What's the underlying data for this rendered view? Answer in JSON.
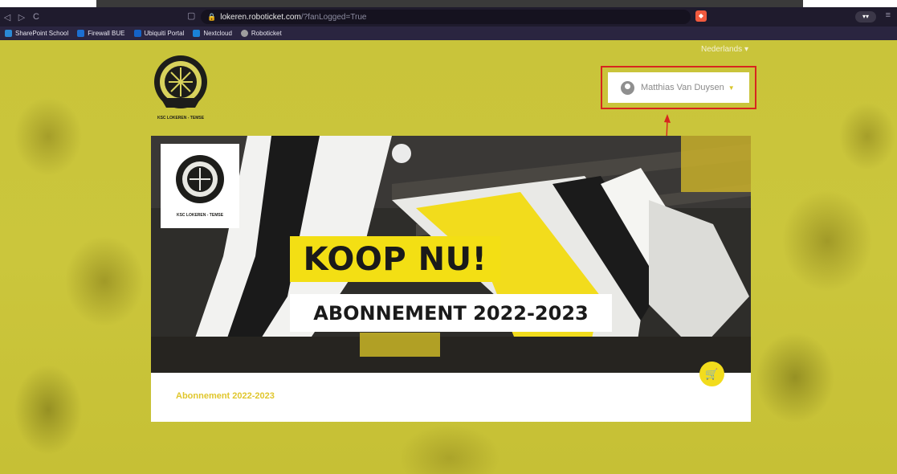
{
  "browser": {
    "url_host": "lokeren.roboticket.com",
    "url_path": "/?fanLogged=True",
    "bookmarks": [
      {
        "label": "SharePoint School",
        "color": "#2b8ad6"
      },
      {
        "label": "Firewall BUE",
        "color": "#1c6fd1"
      },
      {
        "label": "Ubiquiti Portal",
        "color": "#1463c7"
      },
      {
        "label": "Nextcloud",
        "color": "#1a82d8"
      },
      {
        "label": "Roboticket",
        "color": "#9e9e9e"
      }
    ]
  },
  "header": {
    "language": "Nederlands",
    "user_name": "Matthias Van Duysen",
    "logo_text": "KSC LOKEREN - TEMSE"
  },
  "banner": {
    "headline": "KOOP NU!",
    "subheadline": "ABONNEMENT 2022-2023",
    "caption": "Abonnement 2022-2023",
    "accent": "#f3df14"
  }
}
